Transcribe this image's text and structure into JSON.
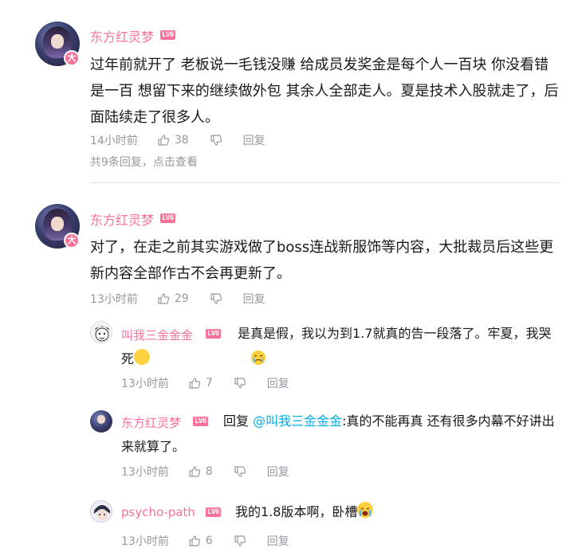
{
  "comments": [
    {
      "username": "东方红灵梦",
      "level": "LV6",
      "avatar_badge": "大",
      "text": "过年前就开了 老板说一毛钱没赚 给成员发奖金是每个人一百块 你没看错 是一百 想留下来的继续做外包 其余人全部走人。夏是技术入股就走了，后面陆续走了很多人。",
      "time": "14小时前",
      "likes": "38",
      "reply_label": "回复",
      "reply_count_text": "共9条回复，点击查看"
    },
    {
      "username": "东方红灵梦",
      "level": "LV6",
      "avatar_badge": "大",
      "text": "对了，在走之前其实游戏做了boss连战新服饰等内容，大批裁员后这些更新内容全部作古不会再更新了。",
      "time": "13小时前",
      "likes": "29",
      "reply_label": "回复"
    }
  ],
  "replies": [
    {
      "username": "叫我三金金金",
      "level": "LV6",
      "text": "是真是假，我以为到1.7就真的告一段落了。牢夏，我哭死",
      "emoji": "sob-face-emoji",
      "time": "13小时前",
      "likes": "7",
      "reply_label": "回复"
    },
    {
      "username": "东方红灵梦",
      "level": "LV6",
      "prefix": "回复 ",
      "mention": "@叫我三金金金",
      "text": ":真的不能再真 还有很多内幕不好讲出来就算了。",
      "time": "13小时前",
      "likes": "8",
      "reply_label": "回复"
    },
    {
      "username": "psycho-path",
      "level": "LV6",
      "text": "我的1.8版本啊，卧槽",
      "emoji": "crying-face-emoji",
      "time": "13小时前",
      "likes": "6",
      "reply_label": "回复"
    }
  ],
  "colors": {
    "username": "#fb7299",
    "meta": "#9499a0",
    "mention": "#00aeec",
    "text": "#18191c"
  }
}
